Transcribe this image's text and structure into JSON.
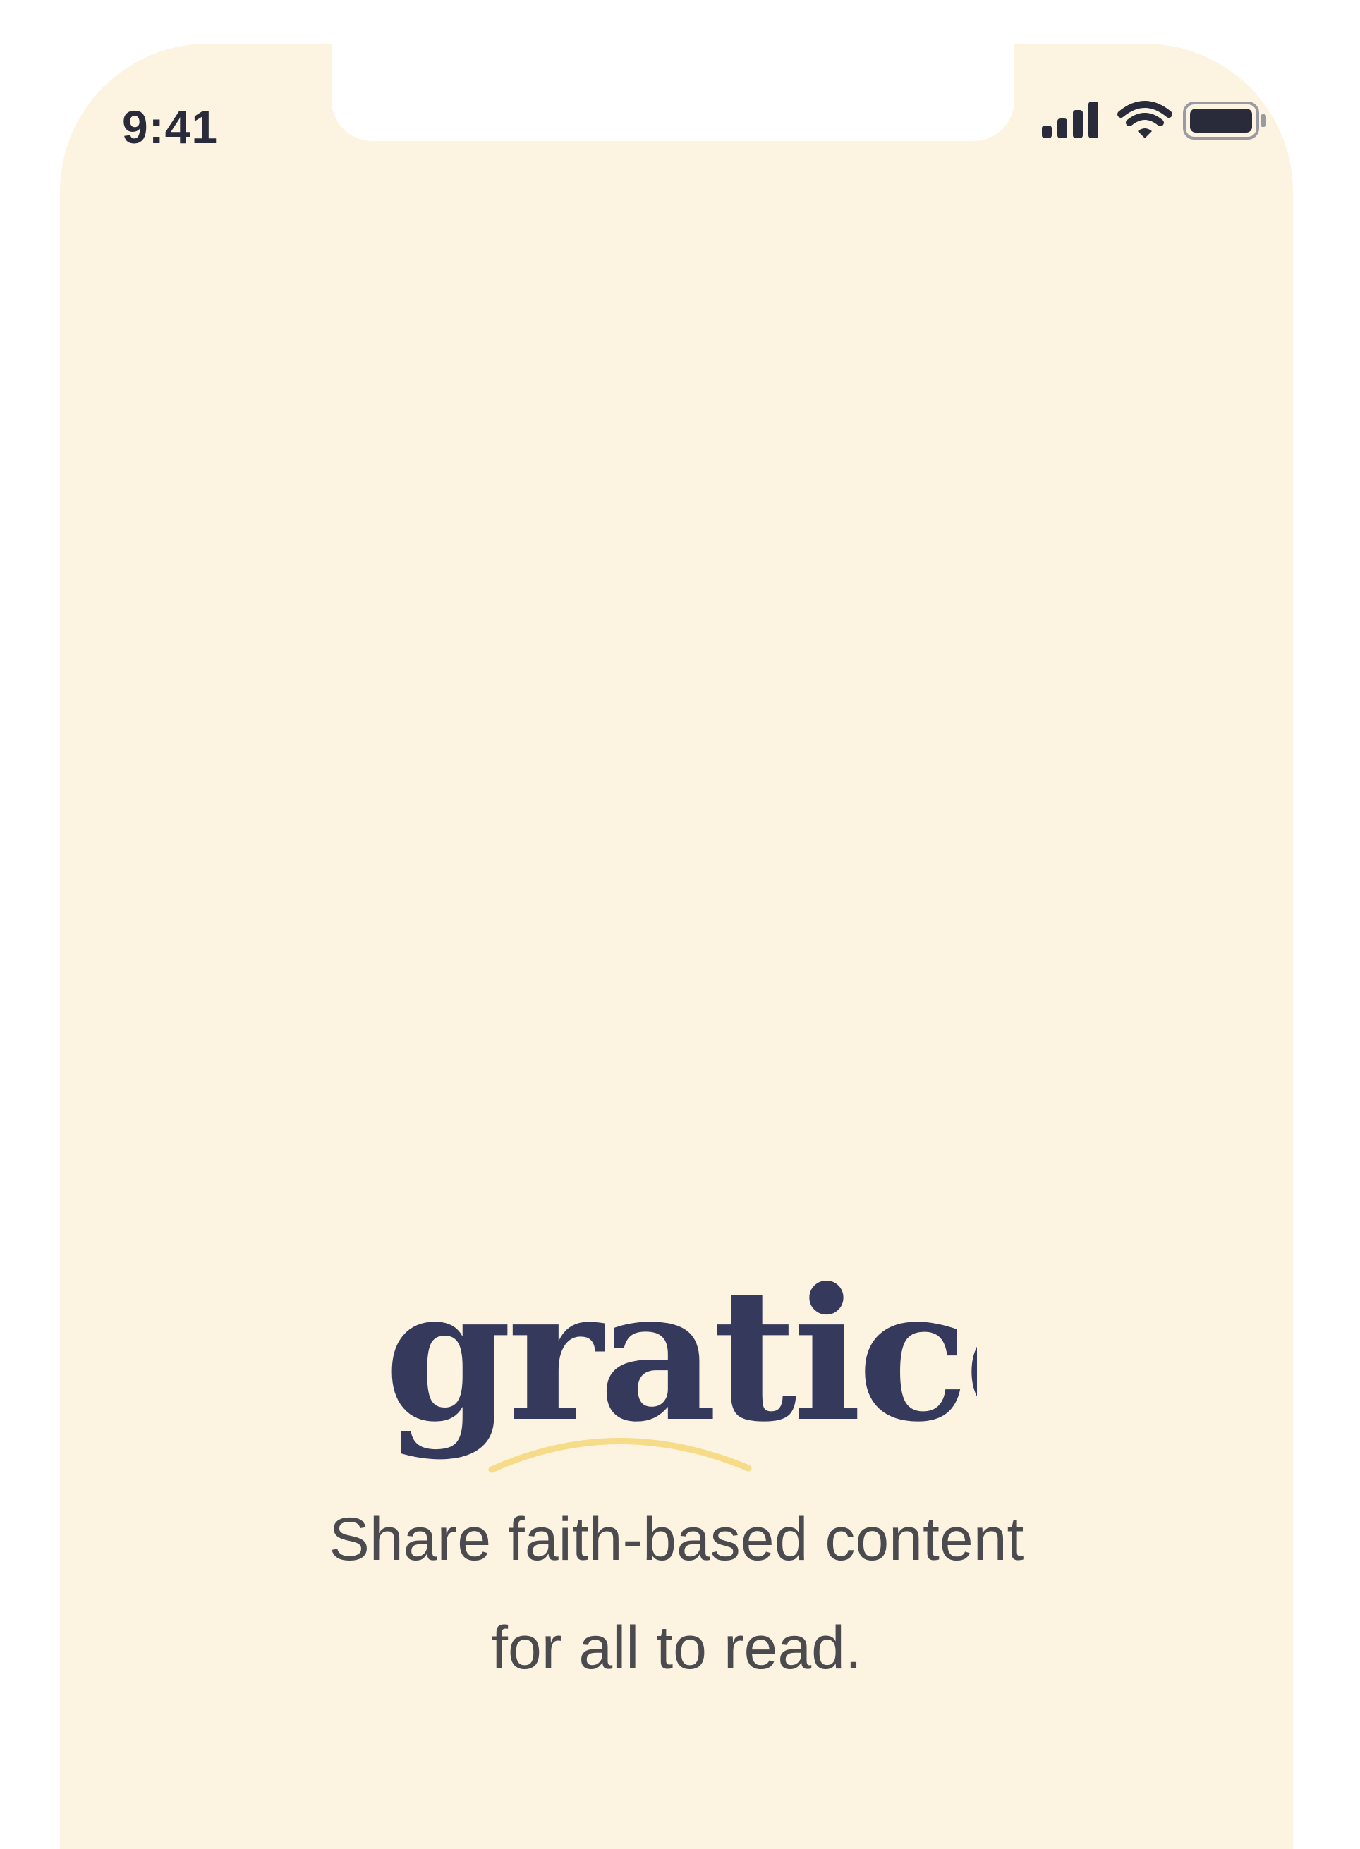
{
  "status_bar": {
    "time": "9:41",
    "icons": [
      "signal-icon",
      "wifi-icon",
      "battery-icon"
    ]
  },
  "brand": {
    "logo_text": "gratico",
    "logo_color": "#353a5c",
    "accent_color": "#f6dc88"
  },
  "tagline": {
    "line1": "Share faith-based content",
    "line2": "for all to read."
  },
  "colors": {
    "background": "#fcf3e0",
    "text": "#4b4b4f"
  }
}
